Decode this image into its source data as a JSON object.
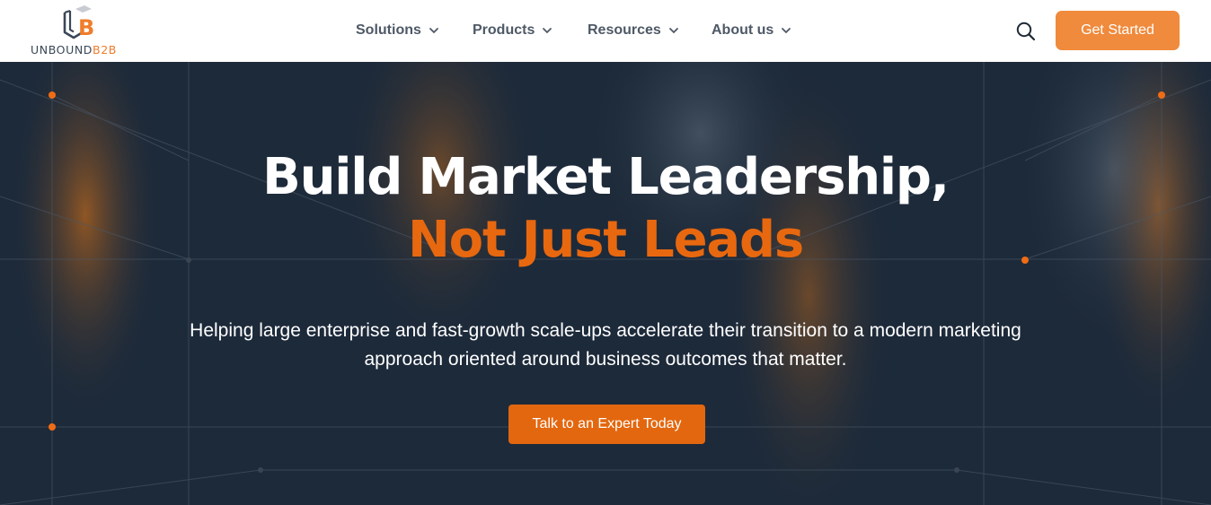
{
  "brand": {
    "logo_text_main": "UNBOUND",
    "logo_text_accent": "B2B",
    "accent_color": "#ef7d2c",
    "logo_icon": "ub-monogram-logo"
  },
  "nav": {
    "items": [
      {
        "label": "Solutions",
        "icon": "chevron-down-icon"
      },
      {
        "label": "Products",
        "icon": "chevron-down-icon"
      },
      {
        "label": "Resources",
        "icon": "chevron-down-icon"
      },
      {
        "label": "About us",
        "icon": "chevron-down-icon"
      }
    ],
    "search_icon": "search-icon",
    "cta_label": "Get Started",
    "cta_color": "#f08a3c"
  },
  "hero": {
    "title_line1": "Build Market Leadership,",
    "title_line2": "Not Just Leads",
    "title_line2_color": "#e8680f",
    "subtitle": "Helping large enterprise and fast-growth scale-ups accelerate their transition to a modern marketing approach oriented around business outcomes that matter.",
    "cta_label": "Talk to an Expert Today",
    "background_color": "#1e2b3b"
  }
}
